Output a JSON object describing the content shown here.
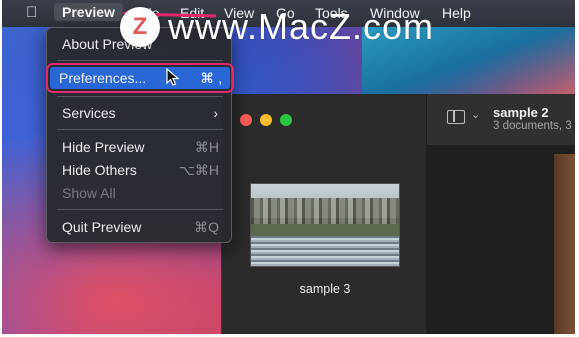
{
  "menubar": {
    "apple_icon": "apple-logo-icon",
    "items": [
      "Preview",
      "File",
      "Edit",
      "View",
      "Go",
      "Tools",
      "Window",
      "Help"
    ]
  },
  "watermark": {
    "logo_letter": "Z",
    "text": "www.MacZ.com"
  },
  "dropdown": {
    "about": "About Preview",
    "preferences": "Preferences...",
    "preferences_shortcut": "⌘ ,",
    "services": "Services",
    "services_chevron": "›",
    "hide": "Hide Preview",
    "hide_shortcut": "⌘H",
    "hide_others": "Hide Others",
    "hide_others_shortcut": "⌥⌘H",
    "show_all": "Show All",
    "quit": "Quit Preview",
    "quit_shortcut": "⌘Q"
  },
  "window": {
    "title": "sample 2",
    "subtitle": "3 documents, 3",
    "sidebar_chevron": "⌄",
    "thumbnail_label": "sample 3"
  },
  "colors": {
    "highlight": "#2a67d6",
    "annotation": "#e3296a",
    "close": "#ff5f57",
    "minimize": "#febc2e",
    "zoom": "#28c840"
  }
}
